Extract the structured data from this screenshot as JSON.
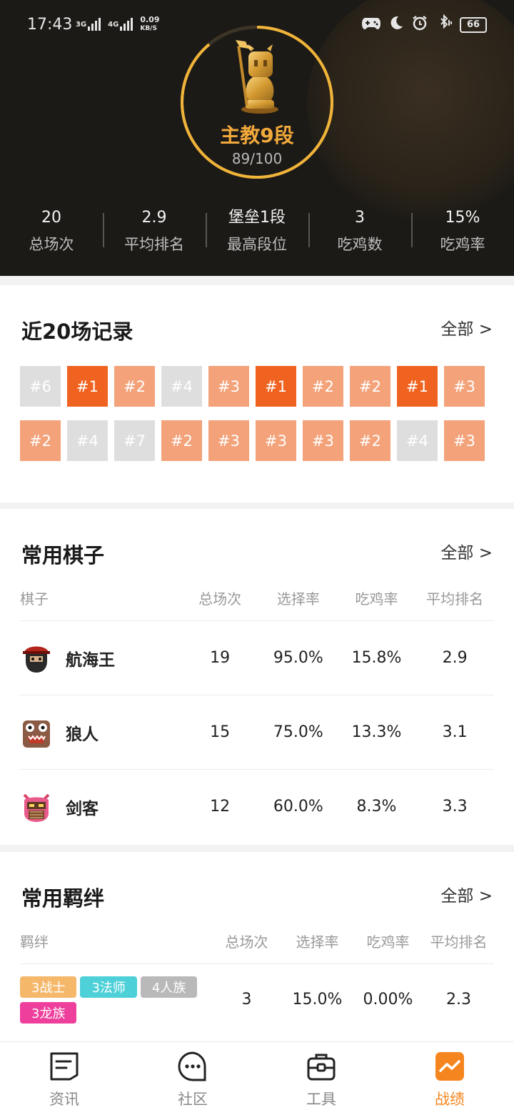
{
  "status_bar": {
    "time": "17:43",
    "net1": "3G",
    "net2": "4G",
    "speed_value": "0.09",
    "speed_unit": "KB/S",
    "battery": "66"
  },
  "profile": {
    "rank_name": "主教9段",
    "rank_progress": "89/100",
    "rank_progress_fraction": 0.89,
    "stats": [
      {
        "value": "20",
        "label": "总场次"
      },
      {
        "value": "2.9",
        "label": "平均排名"
      },
      {
        "value": "堡垒1段",
        "label": "最高段位"
      },
      {
        "value": "3",
        "label": "吃鸡数"
      },
      {
        "value": "15%",
        "label": "吃鸡率"
      }
    ]
  },
  "recent": {
    "title": "近20场记录",
    "all_link": "全部 >",
    "results": [
      "#6",
      "#1",
      "#2",
      "#4",
      "#3",
      "#1",
      "#2",
      "#2",
      "#1",
      "#3",
      "#2",
      "#4",
      "#7",
      "#2",
      "#3",
      "#3",
      "#3",
      "#2",
      "#4",
      "#3"
    ]
  },
  "pieces": {
    "title": "常用棋子",
    "all_link": "全部 >",
    "headers": [
      "棋子",
      "总场次",
      "选择率",
      "吃鸡率",
      "平均排名"
    ],
    "rows": [
      {
        "name": "航海王",
        "games": "19",
        "pick": "95.0%",
        "win": "15.8%",
        "avg": "2.9"
      },
      {
        "name": "狼人",
        "games": "15",
        "pick": "75.0%",
        "win": "13.3%",
        "avg": "3.1"
      },
      {
        "name": "剑客",
        "games": "12",
        "pick": "60.0%",
        "win": "8.3%",
        "avg": "3.3"
      }
    ]
  },
  "bonds": {
    "title": "常用羁绊",
    "all_link": "全部 >",
    "headers": [
      "羁绊",
      "总场次",
      "选择率",
      "吃鸡率",
      "平均排名"
    ],
    "rows": [
      {
        "tags": [
          {
            "label": "3战士",
            "color": "#f5b86a"
          },
          {
            "label": "3法师",
            "color": "#4dd0d8"
          },
          {
            "label": "4人族",
            "color": "#b9b9b9"
          },
          {
            "label": "3龙族",
            "color": "#ee3f9c"
          }
        ],
        "games": "3",
        "pick": "15.0%",
        "win": "0.00%",
        "avg": "2.3"
      }
    ]
  },
  "tabbar": {
    "tabs": [
      {
        "label": "资讯",
        "icon": "news-icon"
      },
      {
        "label": "社区",
        "icon": "chat-bubble-icon"
      },
      {
        "label": "工具",
        "icon": "toolbox-icon"
      },
      {
        "label": "战绩",
        "icon": "trend-chart-icon",
        "active": true
      }
    ]
  },
  "colors": {
    "accent": "#f5861f",
    "rank_gold": "#e0a02a",
    "first_place": "#f06220",
    "top_place": "#f3a27a",
    "low_place": "#dedede"
  }
}
